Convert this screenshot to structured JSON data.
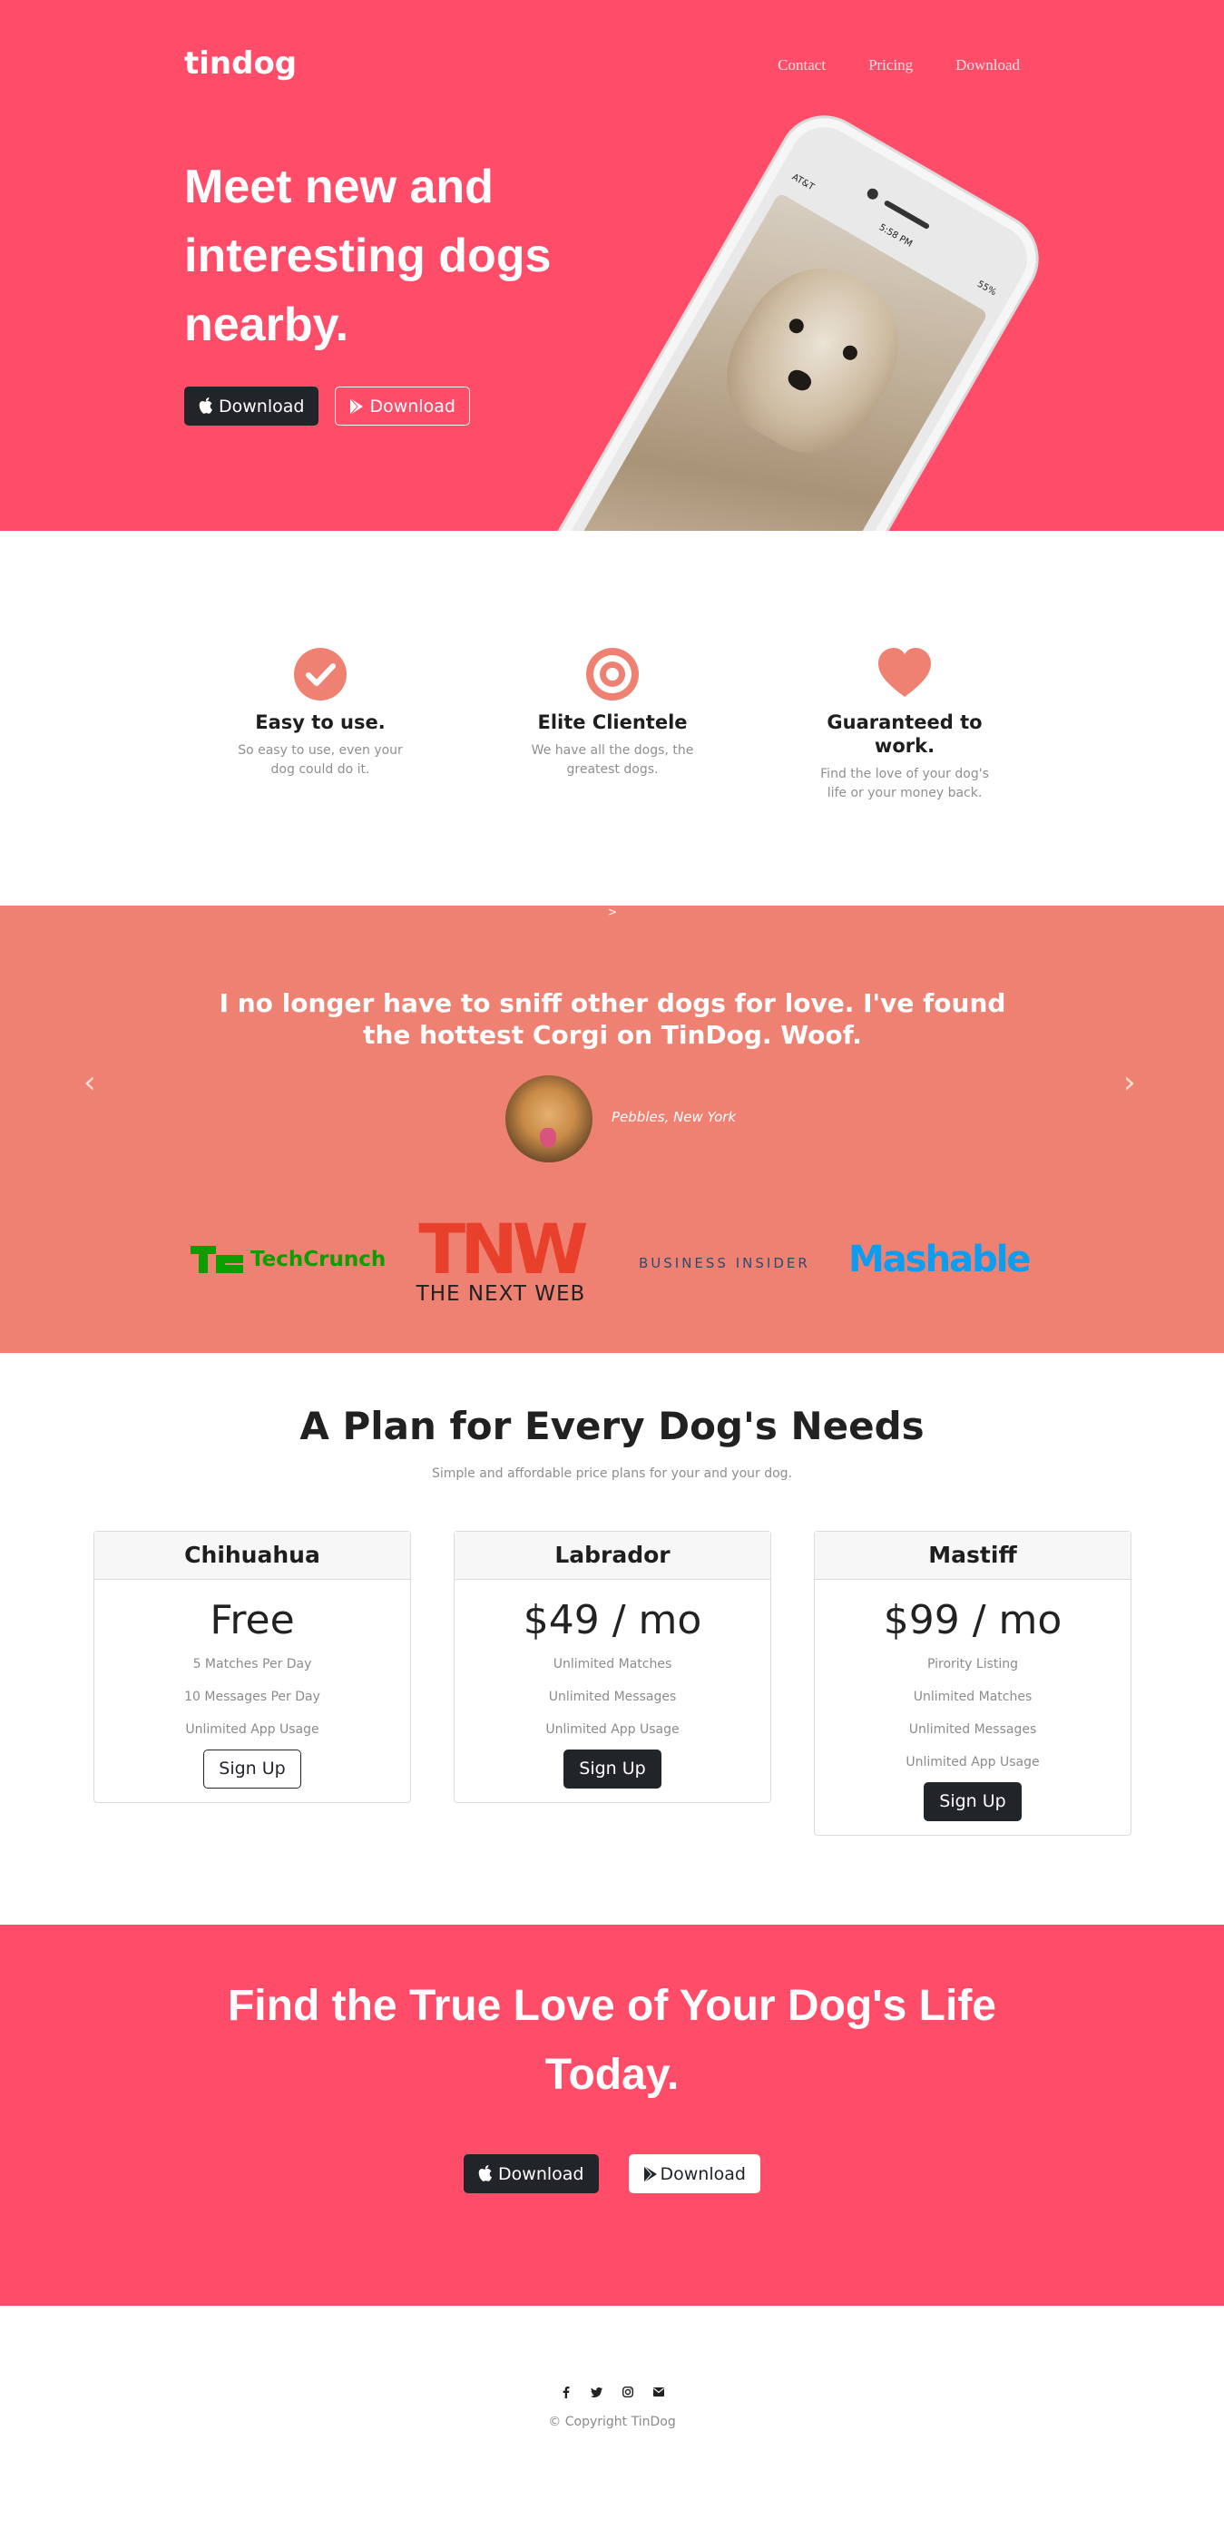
{
  "header": {
    "brand": "tindog",
    "nav": [
      "Contact",
      "Pricing",
      "Download"
    ]
  },
  "hero": {
    "title": "Meet new and interesting dogs nearby.",
    "btn_apple": "Download",
    "btn_play": "Download",
    "phone": {
      "carrier": "AT&T",
      "time": "5:58 PM",
      "battery": "55%"
    }
  },
  "features": [
    {
      "icon": "check-circle-icon",
      "title": "Easy to use.",
      "text": "So easy to use, even your dog could do it."
    },
    {
      "icon": "bullseye-icon",
      "title": "Elite Clientele",
      "text": "We have all the dogs, the greatest dogs."
    },
    {
      "icon": "heart-icon",
      "title": "Guaranteed to work.",
      "text": "Find the love of your dog's life or your money back."
    }
  ],
  "testimonial": {
    "caret": ">",
    "quote": "I no longer have to sniff other dogs for love. I've found the hottest Corgi on TinDog. Woof.",
    "author": "Pebbles, New York",
    "prev": "‹",
    "next": "›"
  },
  "press": {
    "techcrunch": "TechCrunch",
    "tnw": "TNW",
    "tnw_sub": "THE NEXT WEB",
    "business_insider": "BUSINESS INSIDER",
    "mashable": "Mashable"
  },
  "pricing": {
    "title": "A Plan for Every Dog's Needs",
    "subtitle": "Simple and affordable price plans for your and your dog.",
    "plans": [
      {
        "name": "Chihuahua",
        "price": "Free",
        "features": [
          "5 Matches Per Day",
          "10 Messages Per Day",
          "Unlimited App Usage"
        ],
        "button": "Sign Up"
      },
      {
        "name": "Labrador",
        "price": "$49 / mo",
        "features": [
          "Unlimited Matches",
          "Unlimited Messages",
          "Unlimited App Usage"
        ],
        "button": "Sign Up"
      },
      {
        "name": "Mastiff",
        "price": "$99 / mo",
        "features": [
          "Pirority Listing",
          "Unlimited Matches",
          "Unlimited Messages",
          "Unlimited App Usage"
        ],
        "button": "Sign Up"
      }
    ]
  },
  "cta": {
    "title": "Find the True Love of Your Dog's Life Today.",
    "btn_apple": "Download",
    "btn_play": "Download"
  },
  "footer": {
    "social": [
      "facebook-icon",
      "twitter-icon",
      "instagram-icon",
      "envelope-icon"
    ],
    "copyright": "© Copyright TinDog"
  },
  "colors": {
    "primary": "#ff4c68",
    "secondary": "#ef8172",
    "dark": "#212529"
  }
}
